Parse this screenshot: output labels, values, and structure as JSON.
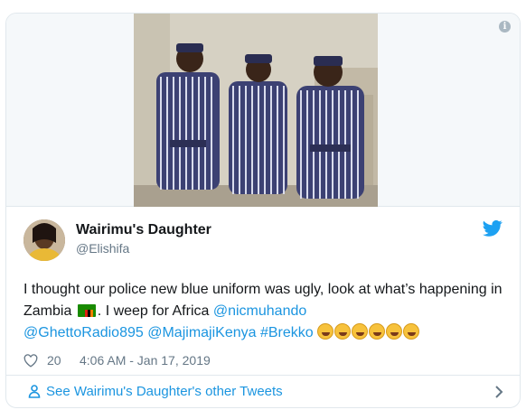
{
  "media": {
    "info_icon": "info-icon",
    "image_description_icon": "photo"
  },
  "author": {
    "display_name": "Wairimu's Daughter",
    "handle": "@Elishifa",
    "platform_icon": "twitter-bird-icon"
  },
  "tweet": {
    "text_part1": "I thought our police new blue uniform was ugly, look at what’s happening in Zambia ",
    "flag_icon": "zambia-flag-icon",
    "text_part2": ". I weep for Africa  ",
    "mention1": "@nicmuhando",
    "mention2": "@GhettoRadio895",
    "mention3": "@MajimajiKenya",
    "hashtag": "#Brekko",
    "emoji_icon": "rolling-on-floor-laughing-emoji",
    "emoji_count": 6
  },
  "meta": {
    "likes": "20",
    "timestamp": "4:06 AM - Jan 17, 2019"
  },
  "footer": {
    "link_text": "See Wairimu's Daughter's other Tweets"
  },
  "colors": {
    "link": "#1b95e0",
    "secondary_text": "#657786",
    "border": "#e1e8ed",
    "flag_green": "#198a00"
  }
}
